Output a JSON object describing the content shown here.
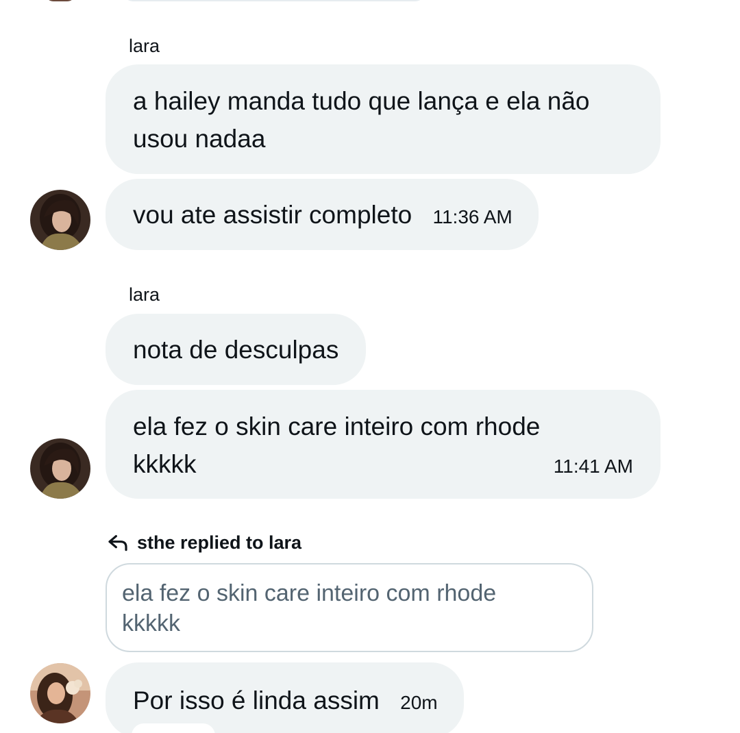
{
  "messages": {
    "group1": {
      "sender": "lara",
      "bubble1_text": "a hailey manda tudo que lança e ela não usou nadaa",
      "bubble2_text": "vou ate assistir completo",
      "bubble2_time": "11:36 AM"
    },
    "group2": {
      "sender": "lara",
      "bubble1_text": "nota de desculpas",
      "bubble2_line1": "ela fez o skin care inteiro com rhode",
      "bubble2_line2": "kkkkk",
      "bubble2_time": "11:41 AM"
    },
    "reply": {
      "label": "sthe replied to lara",
      "quote_line1": "ela fez o skin care inteiro com rhode",
      "quote_line2": "kkkkk",
      "text": "Por isso é linda assim",
      "time": "20m"
    }
  },
  "icons": {
    "reply": "reply-arrow-icon"
  },
  "colors": {
    "bubble_bg": "#eff3f4",
    "quote_border": "#cfd9de",
    "quote_text": "#536471",
    "text": "#0f1419"
  }
}
